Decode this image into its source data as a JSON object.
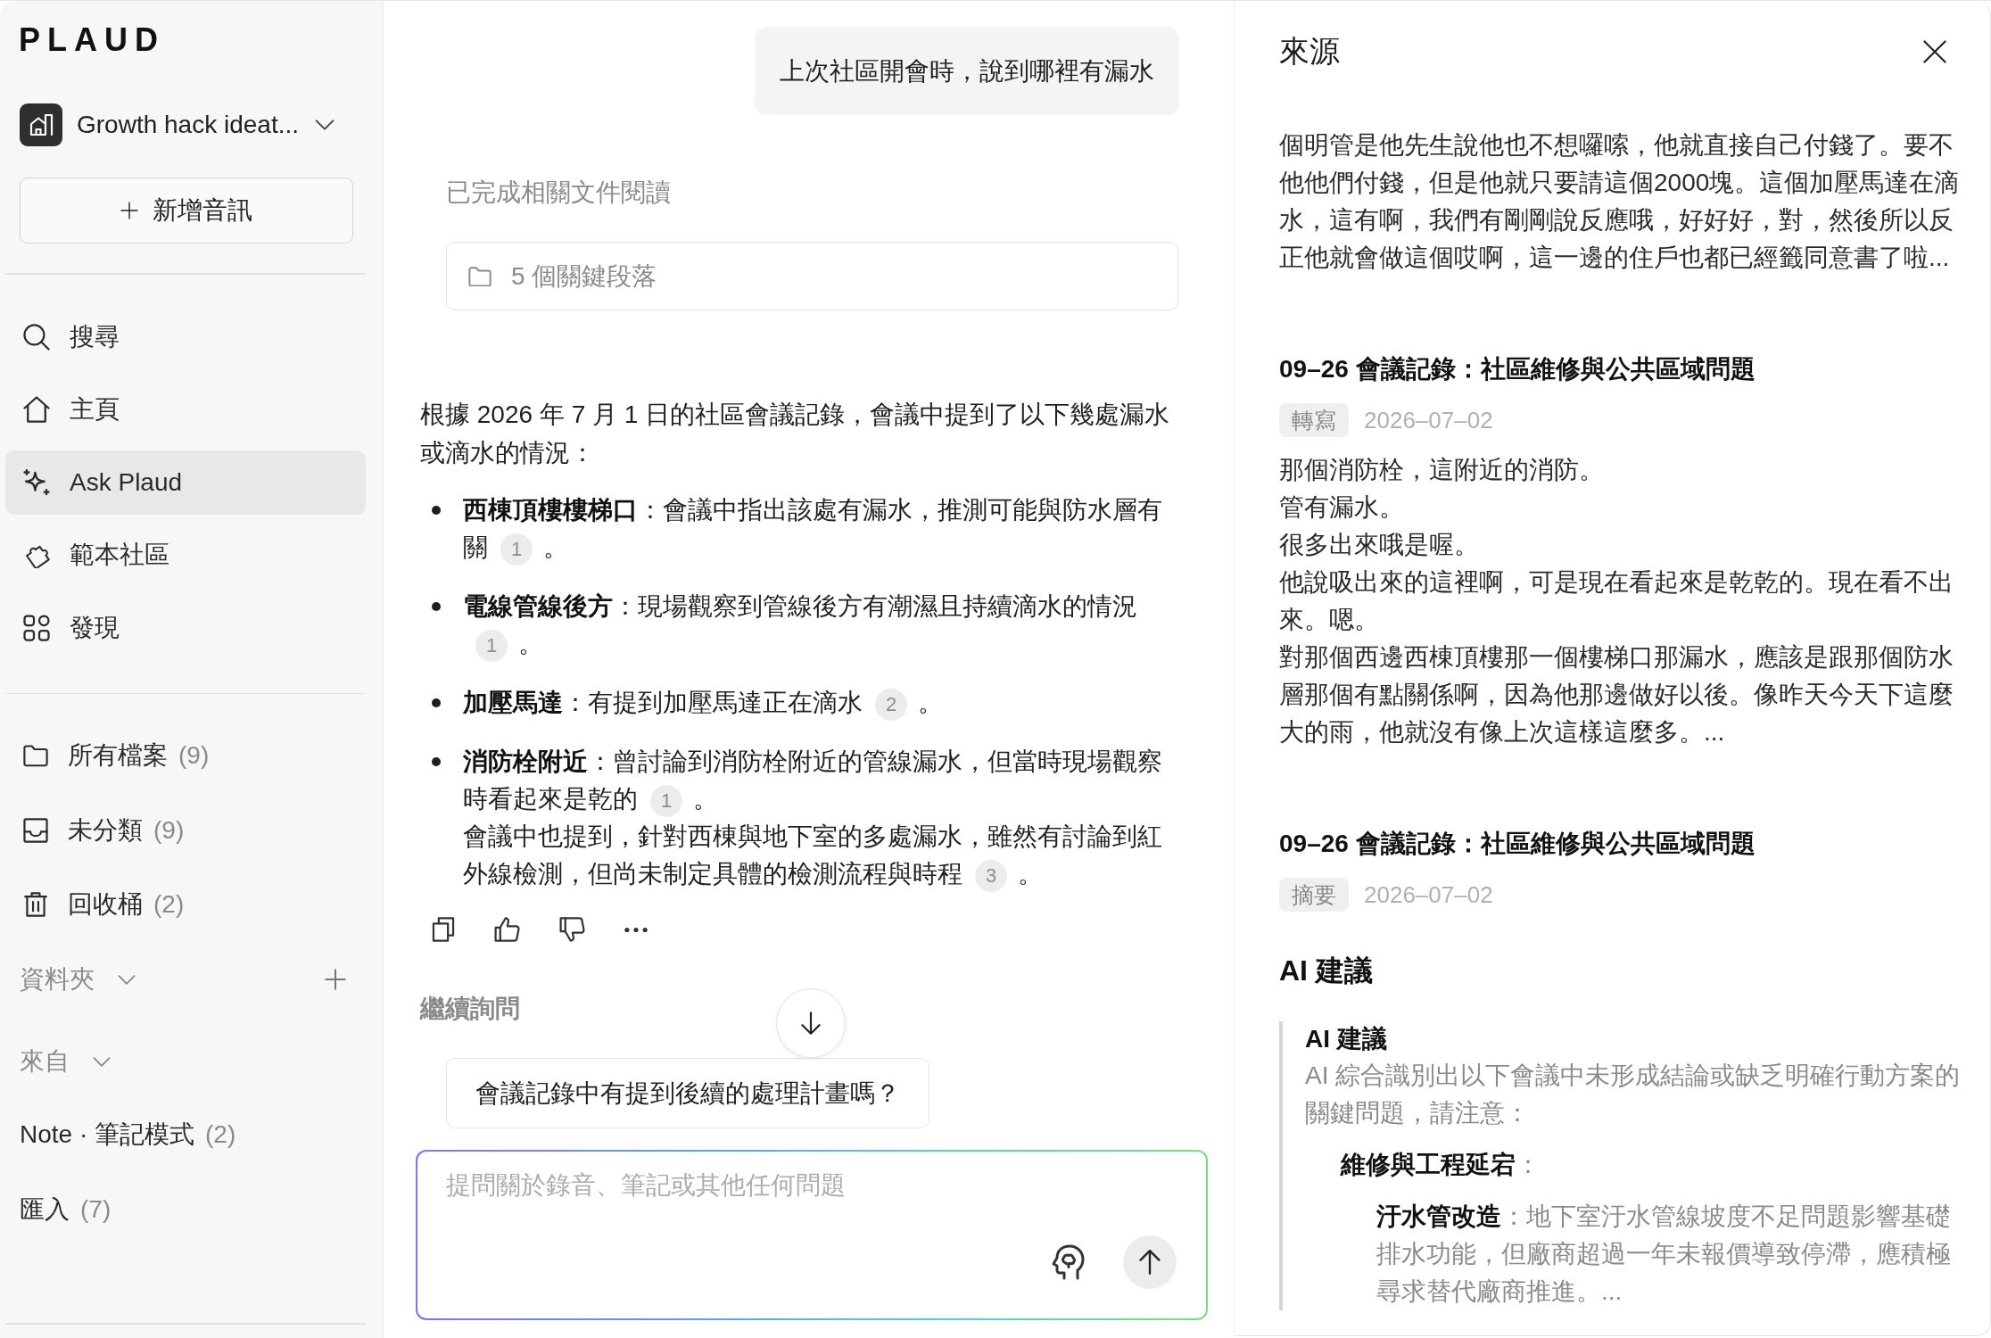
{
  "sidebar": {
    "logo": "PLAUD",
    "workspace": "Growth hack ideat...",
    "new_button": "新增音訊",
    "nav": [
      {
        "label": "搜尋",
        "selected": false
      },
      {
        "label": "主頁",
        "selected": false
      },
      {
        "label": "Ask Plaud",
        "selected": true
      },
      {
        "label": "範本社區",
        "selected": false
      },
      {
        "label": "發現",
        "selected": false
      }
    ],
    "libraries": [
      {
        "label": "所有檔案",
        "count": "(9)",
        "selected": false
      },
      {
        "label": "未分類",
        "count": "(9)",
        "selected": false
      },
      {
        "label": "回收桶",
        "count": "(2)",
        "selected": false
      }
    ],
    "folders": {
      "label": "資料夾"
    },
    "sources": {
      "label": "來自",
      "items": [
        {
          "label": "Note · 筆記模式",
          "count": "(2)",
          "selected": false
        },
        {
          "label": "匯入",
          "count": "(7)",
          "selected": false
        }
      ]
    }
  },
  "chat": {
    "user_message": "上次社區開會時，說到哪裡有漏水",
    "status": "已完成相關文件閱讀",
    "passages": "5 個關鍵段落",
    "answer": {
      "intro": "根據 2026 年 7 月 1 日的社區會議記錄，會議中提到了以下幾處漏水或滴水的情況：",
      "bullets": [
        {
          "paragraphs": [
            {
              "parts": [
                {
                  "kind": "text",
                  "text": "**西棟頂樓樓梯口**：會議中指出該處有漏水，推測可能與防水層有關"
                },
                {
                  "kind": "citation",
                  "label": "1"
                },
                {
                  "kind": "text",
                  "text": "。"
                }
              ]
            }
          ]
        },
        {
          "paragraphs": [
            {
              "parts": [
                {
                  "kind": "text",
                  "text": "**電線管線後方**：現場觀察到管線後方有潮濕且持續滴水的情況"
                },
                {
                  "kind": "citation",
                  "label": "1"
                },
                {
                  "kind": "text",
                  "text": "。"
                }
              ]
            }
          ]
        },
        {
          "paragraphs": [
            {
              "parts": [
                {
                  "kind": "text",
                  "text": "**加壓馬達**：有提到加壓馬達正在滴水"
                },
                {
                  "kind": "citation",
                  "label": "2"
                },
                {
                  "kind": "text",
                  "text": "。"
                }
              ]
            }
          ]
        },
        {
          "paragraphs": [
            {
              "parts": [
                {
                  "kind": "text",
                  "text": "**消防栓附近**：曾討論到消防栓附近的管線漏水，但當時現場觀察時看起來是乾的"
                },
                {
                  "kind": "citation",
                  "label": "1"
                },
                {
                  "kind": "text",
                  "text": "。"
                }
              ]
            },
            {
              "parts": [
                {
                  "kind": "text",
                  "text": "會議中也提到，針對西棟與地下室的多處漏水，雖然有討論到紅外線檢測，但尚未制定具體的檢測流程與時程"
                },
                {
                  "kind": "citation",
                  "label": "3"
                },
                {
                  "kind": "text",
                  "text": "。"
                }
              ]
            }
          ]
        }
      ]
    },
    "follow_up_label": "繼續詢問",
    "suggestions": [
      "會議記錄中有提到後續的處理計畫嗎？"
    ],
    "input": {
      "placeholder": "提問關於錄音、筆記或其他任何問題"
    }
  },
  "sources_panel": {
    "title": "來源",
    "items": [
      {
        "kind": "excerpt",
        "text": "個明管是他先生說他也不想囉嗦，他就直接自己付錢了。要不他他們付錢，但是他就只要請這個2000塊。這個加壓馬達在滴水，這有啊，我們有剛剛說反應哦，好好好，對，然後所以反正他就會做這個哎啊，這一邊的住戶也都已經籤同意書了啦..."
      },
      {
        "kind": "transcript",
        "title": "09–26 會議記錄：社區維修與公共區域問題",
        "tag": "轉寫",
        "date": "2026–07–02",
        "lines": [
          "那個消防栓，這附近的消防。",
          "管有漏水。",
          "很多出來哦是喔。",
          "他說吸出來的這裡啊，可是現在看起來是乾乾的。現在看不出來。嗯。",
          "對那個西邊西棟頂樓那一個樓梯口那漏水，應該是跟那個防水層那個有點關係啊，因為他那邊做好以後。像昨天今天下這麼大的雨，他就沒有像上次這樣這麼多。..."
        ]
      },
      {
        "kind": "summary",
        "title": "09–26 會議記錄：社區維修與公共區域問題",
        "tag": "摘要",
        "date": "2026–07–02",
        "heading": "AI 建議",
        "quote": {
          "title": "AI 建議",
          "text": "AI 綜合識別出以下會議中未形成結論或缺乏明確行動方案的關鍵問題，請注意：",
          "outline": [
            {
              "text": "**維修與工程延宕**：",
              "children": [
                {
                  "text": "**汙水管改造**：地下室汙水管線坡度不足問題影響基礎排水功能，但廠商超過一年未報價導致停滯，應積極尋求替代廠商推進。..."
                }
              ]
            }
          ]
        }
      }
    ]
  }
}
